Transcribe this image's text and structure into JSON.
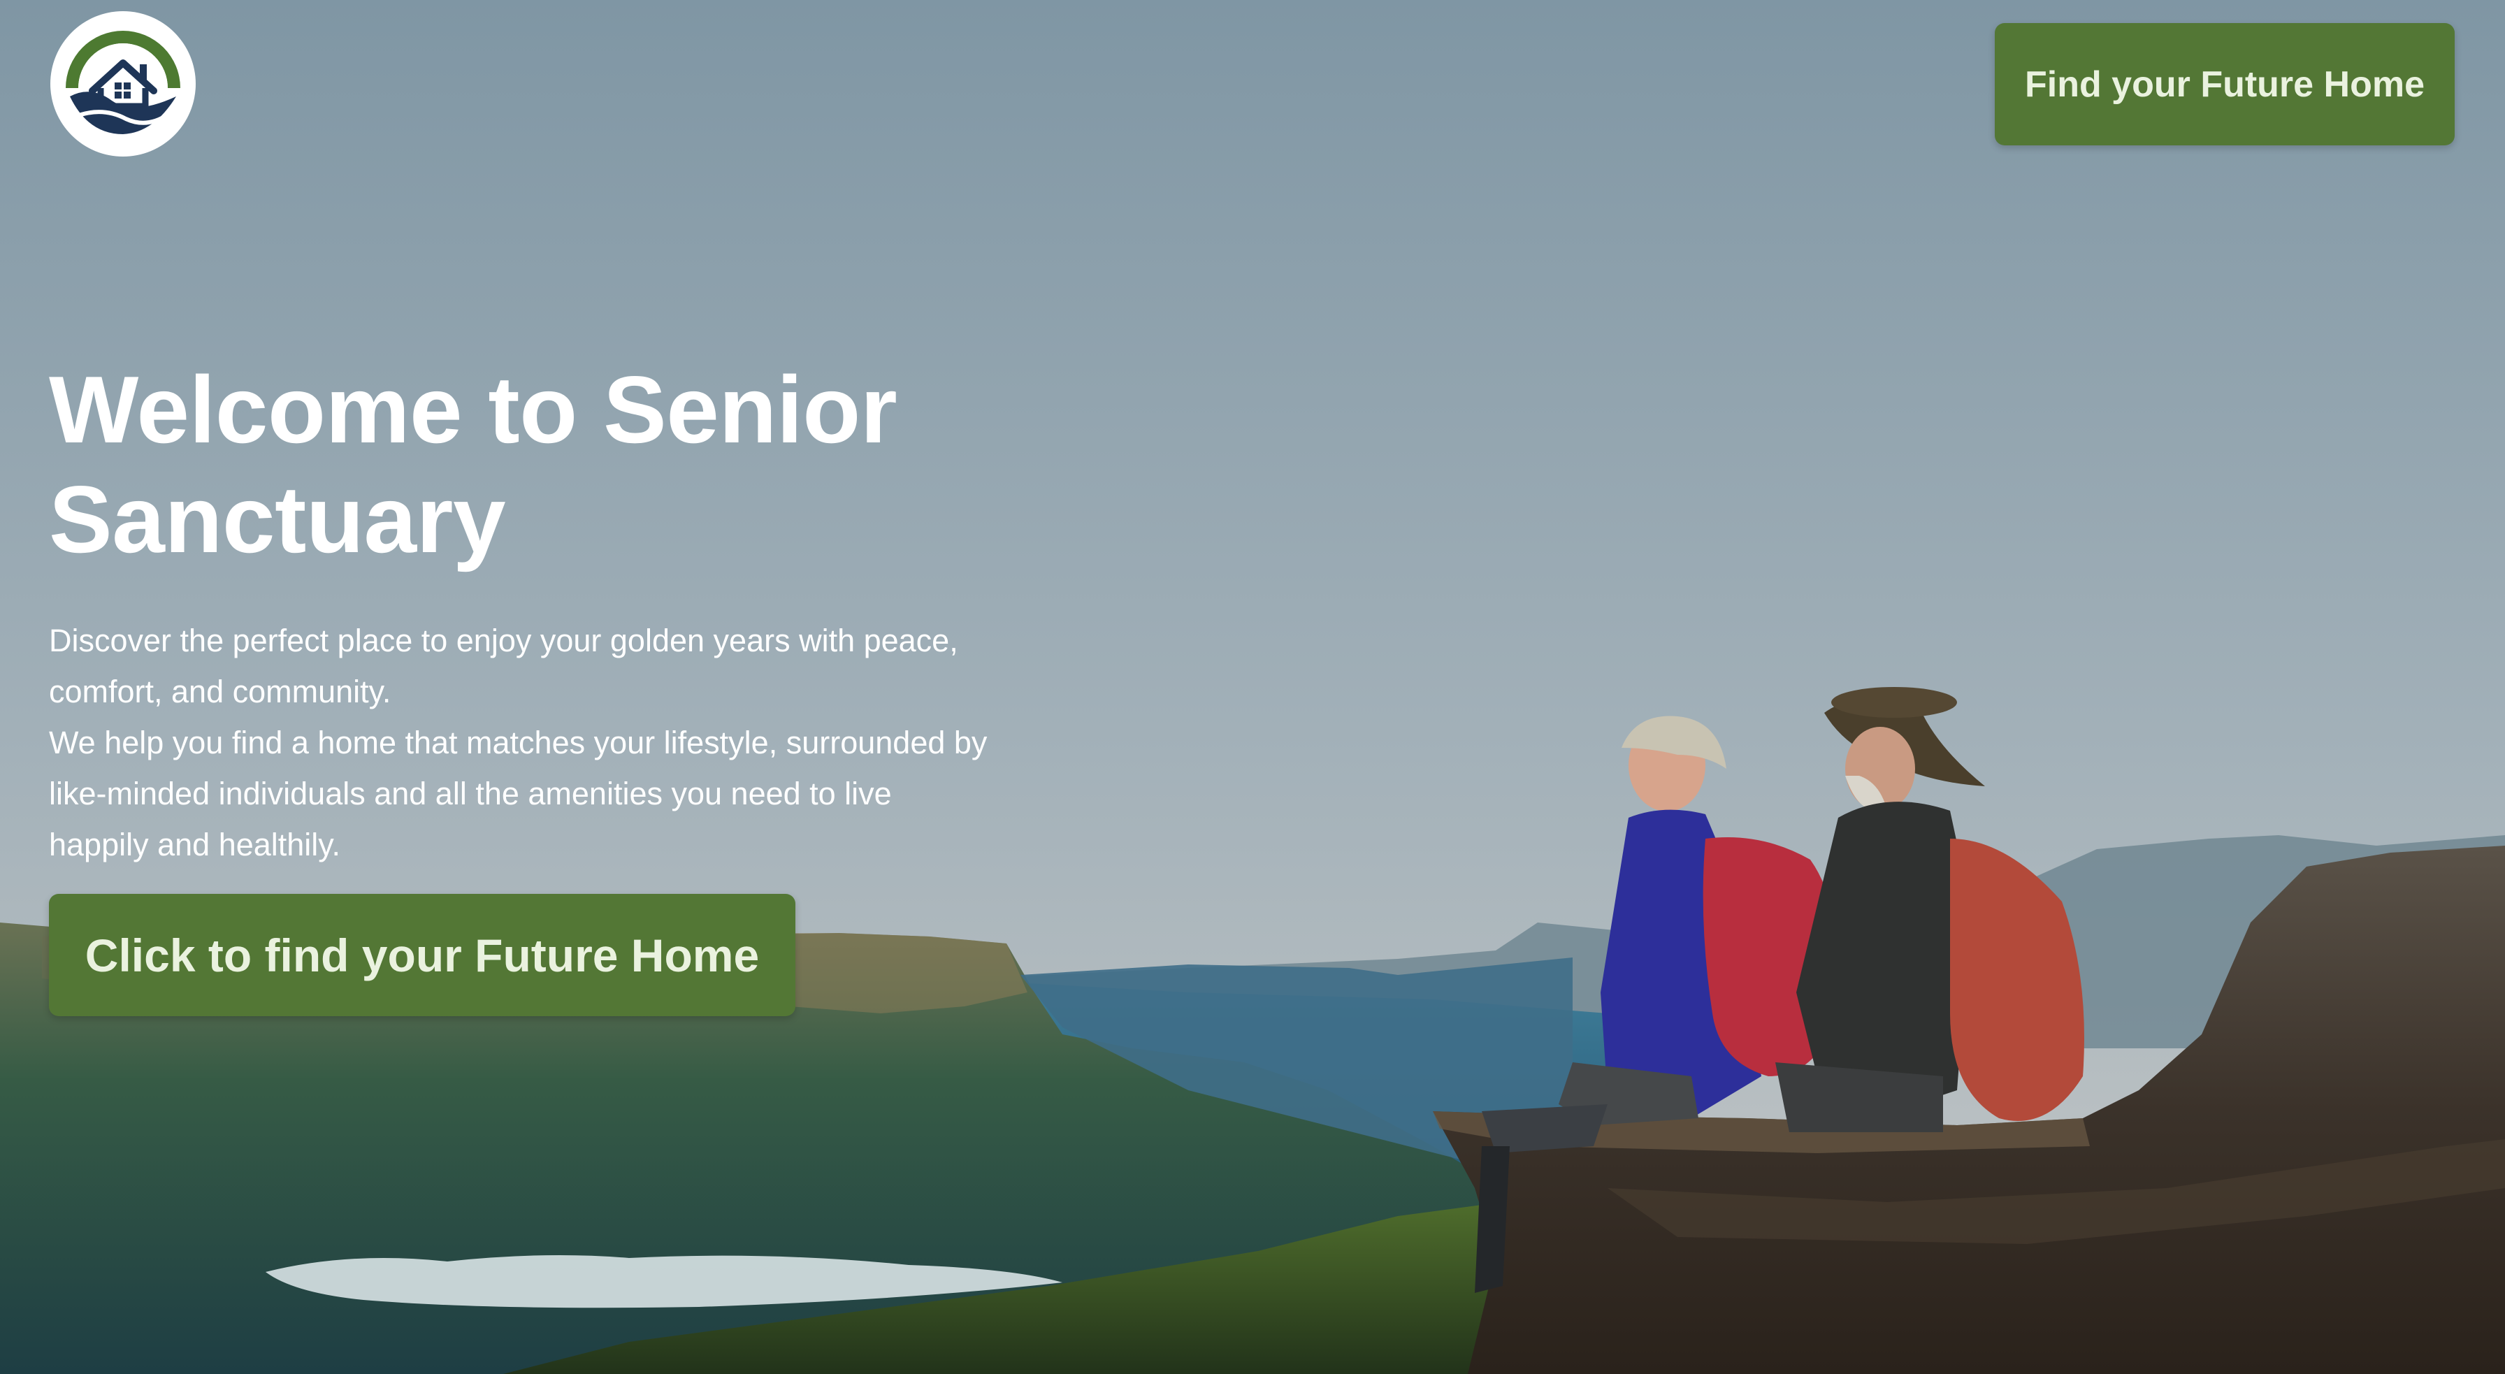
{
  "colors": {
    "sky_top": "#7f96a4",
    "sky_bottom": "#bfc4c6",
    "button_green": "#537735",
    "button_text": "#eaf2df",
    "text_white": "#ffffff",
    "logo_green": "#4d7a31",
    "logo_navy": "#1e3557"
  },
  "header": {
    "cta_label": "Find your Future Home"
  },
  "hero": {
    "title": "Welcome to Senior Sanctuary",
    "paragraph1": "Discover the perfect place to enjoy your golden years with peace, comfort, and community.",
    "paragraph2": "We help you find a home that matches your lifestyle, surrounded by like-minded individuals and all the amenities you need to live happily and healthily.",
    "cta_label": "Click to find your Future Home"
  },
  "icons": {
    "logo": "house-on-waves-logo"
  }
}
